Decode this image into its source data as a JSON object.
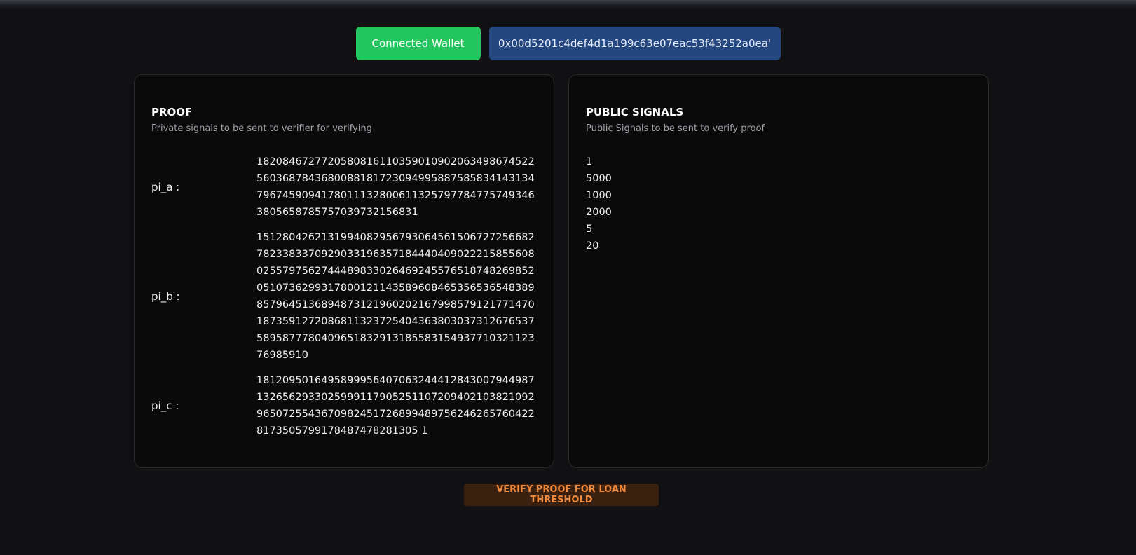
{
  "wallet": {
    "connected_label": "Connected Wallet",
    "address": "0x00d5201c4def4d1a199c63e07eac53f43252a0ea'"
  },
  "proof": {
    "title": "PROOF",
    "subtitle": "Private signals to be sent to verifier for verifying",
    "pi_a_label": "pi_a :",
    "pi_a_value": "1820846727720580816110359010902063498674522560368784368008818172309499588758583414313479674590941780111328006113257977847757493463805658785757039732156831",
    "pi_b_label": "pi_b :",
    "pi_b_value": "151280426213199408295679306456150672725668278233833709290331963571844404090222158556080255797562744489833026469245576518748269852051073629931780012114358960846535653654838985796451368948731219602021679985791217714701873591272086811323725404363803037312676537589587778040965183291318558315493771032112376985910",
    "pi_c_label": "pi_c :",
    "pi_c_value": "1812095016495899956407063244412843007944987132656293302599911790525110720940210382109296507255436709824517268994897562462657604228173505799178487478281305 1"
  },
  "public_signals": {
    "title": "PUBLIC SIGNALS",
    "subtitle": "Public Signals to be sent to verify proof",
    "values": [
      "1",
      "5000",
      "1000",
      "2000",
      "5",
      "20"
    ]
  },
  "actions": {
    "verify_label": "VERIFY PROOF FOR LOAN THRESHOLD"
  },
  "colors": {
    "background": "#111113",
    "card": "#0a0a0b",
    "connected_green": "#22c55e",
    "address_blue": "#244780",
    "verify_text": "#f08a3c",
    "verify_bg": "#3a200f"
  }
}
